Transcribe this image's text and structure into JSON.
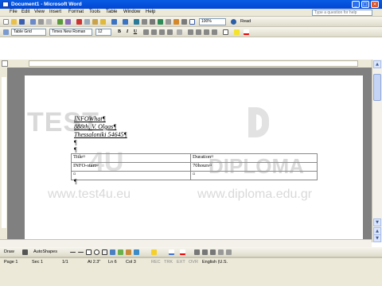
{
  "window": {
    "title": "Document1 - Microsoft Word"
  },
  "menu": {
    "items": [
      "File",
      "Edit",
      "View",
      "Insert",
      "Format",
      "Tools",
      "Table",
      "Window",
      "Help"
    ],
    "ask_placeholder": "Type a question for help"
  },
  "standard_toolbar": {
    "zoom": "100%",
    "read_label": "Read"
  },
  "formatting_toolbar": {
    "style": "Table Grid",
    "font": "Times New Roman",
    "size": "12"
  },
  "document": {
    "lines": [
      "INFOWhat¶",
      "888th, V. Olgas¶",
      "Thessaloniki 54645¶",
      "¶",
      "¶"
    ],
    "table": [
      [
        "Title¤",
        "Duration¤"
      ],
      [
        "INFO-start¤",
        "70hours¤"
      ],
      [
        "¤",
        "¤"
      ]
    ],
    "end_mark": "¶"
  },
  "watermark": {
    "left_brand": "TEST",
    "left_brand_num": "4U",
    "left_url": "www.test4u.eu",
    "right_brand": "DIPLOMA",
    "right_url": "www.diploma.edu.gr"
  },
  "drawing_toolbar": {
    "draw_label": "Draw",
    "autoshapes_label": "AutoShapes"
  },
  "status": {
    "page": "Page 1",
    "sec": "Sec 1",
    "pages": "1/1",
    "at": "At 2.3\"",
    "ln": "Ln 6",
    "col": "Col 3",
    "rec": "REC",
    "trk": "TRK",
    "ext": "EXT",
    "ovr": "OVR",
    "lang": "English (U.S."
  },
  "colors": {
    "titlebar": "#0a5ce4",
    "chrome": "#ece9d8",
    "workspace": "#808080"
  }
}
